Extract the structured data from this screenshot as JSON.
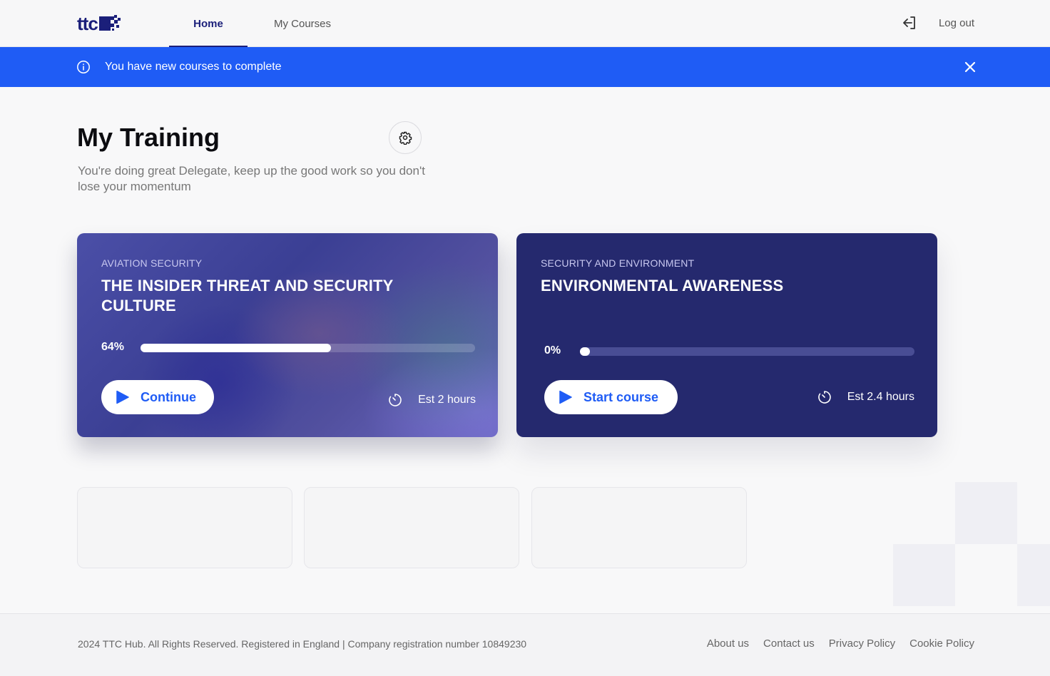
{
  "header": {
    "logo_text": "ttc",
    "nav": [
      {
        "label": "Home",
        "active": true
      },
      {
        "label": "My Courses",
        "active": false
      }
    ],
    "logout_label": "Log out"
  },
  "banner": {
    "message": "You have new courses to complete",
    "color": "#1f5cf5"
  },
  "main": {
    "title": "My Training",
    "subtitle": "You're doing great Delegate, keep up the good work so you don't lose your momentum"
  },
  "courses": [
    {
      "category": "AVIATION SECURITY",
      "title": "THE INSIDER THREAT AND SECURITY CULTURE",
      "progress_label": "64%",
      "progress": 0.57,
      "button_label": "Continue",
      "estimate": "Est 2 hours"
    },
    {
      "category": "SECURITY AND ENVIRONMENT",
      "title": "ENVIRONMENTAL AWARENESS",
      "progress_label": "0%",
      "progress": 0,
      "button_label": "Start course",
      "estimate": "Est 2.4 hours"
    }
  ],
  "footer": {
    "copyright": "2024 TTC Hub. All Rights Reserved. Registered in England | Company registration number 10849230",
    "links": [
      "About us",
      "Contact us",
      "Privacy Policy",
      "Cookie Policy"
    ]
  },
  "colors": {
    "brand_navy": "#1b1f7a",
    "accent_blue": "#1f5cf5",
    "card_navy": "#25296e"
  }
}
